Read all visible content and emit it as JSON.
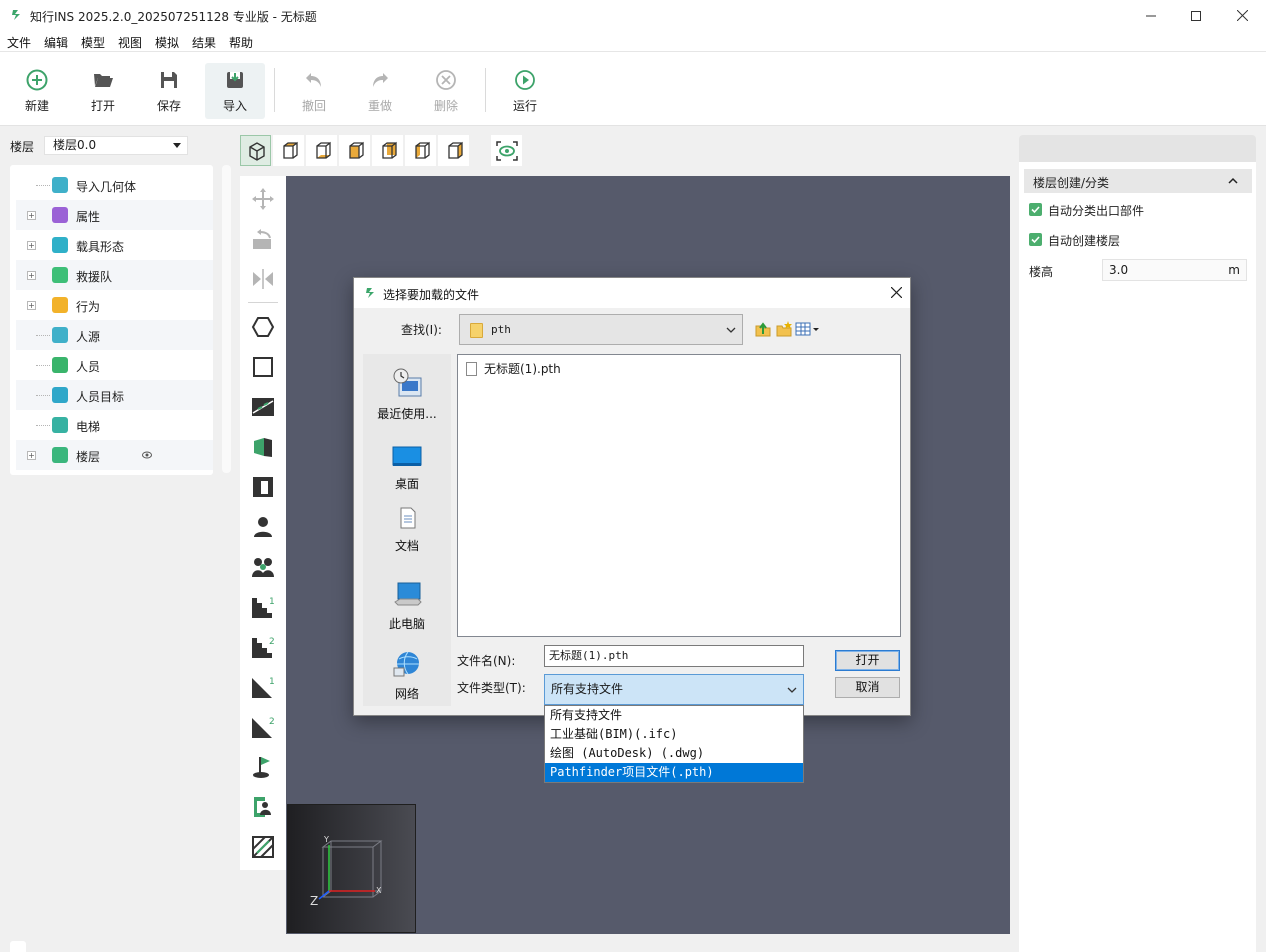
{
  "app": {
    "title": "知行INS 2025.2.0_202507251128 专业版 - 无标题"
  },
  "menu": [
    "文件",
    "编辑",
    "模型",
    "视图",
    "模拟",
    "结果",
    "帮助"
  ],
  "toolbar": {
    "new": "新建",
    "open": "打开",
    "save": "保存",
    "import": "导入",
    "undo": "撤回",
    "redo": "重做",
    "delete": "删除",
    "run": "运行"
  },
  "floor": {
    "label": "楼层",
    "selected": "楼层0.0"
  },
  "tree": [
    {
      "label": "导入几何体",
      "expandable": false,
      "color": "#3fb0c9"
    },
    {
      "label": "属性",
      "expandable": true,
      "color": "#9b62d6"
    },
    {
      "label": "载具形态",
      "expandable": true,
      "color": "#2fb0c8"
    },
    {
      "label": "救援队",
      "expandable": true,
      "color": "#3ebf78"
    },
    {
      "label": "行为",
      "expandable": true,
      "color": "#f2b22a"
    },
    {
      "label": "人源",
      "expandable": false,
      "color": "#3fb0c9"
    },
    {
      "label": "人员",
      "expandable": false,
      "color": "#39b46b"
    },
    {
      "label": "人员目标",
      "expandable": false,
      "color": "#2fa7c9"
    },
    {
      "label": "电梯",
      "expandable": false,
      "color": "#37b2a2"
    },
    {
      "label": "楼层",
      "expandable": true,
      "color": "#3ab67d"
    }
  ],
  "right_panel": {
    "section": "楼层创建/分类",
    "auto_classify": "自动分类出口部件",
    "auto_create": "自动创建楼层",
    "height_label": "楼高",
    "height_value": "3.0",
    "height_unit": "m"
  },
  "dialog": {
    "title": "选择要加载的文件",
    "look_in_label": "查找(I):",
    "look_in_value": "pth",
    "places": [
      "最近使用...",
      "桌面",
      "文档",
      "此电脑",
      "网络"
    ],
    "files": [
      "无标题(1).pth"
    ],
    "filename_label": "文件名(N):",
    "filename_value": "无标题(1).pth",
    "filetype_label": "文件类型(T):",
    "filetype_value": "所有支持文件",
    "open_button": "打开",
    "cancel_button": "取消",
    "filetype_options": [
      "所有支持文件",
      "工业基础(BIM)(.ifc)",
      "绘图 (AutoDesk) (.dwg)",
      "Pathfinder项目文件(.pth)"
    ],
    "filetype_highlighted": "Pathfinder项目文件(.pth)"
  },
  "navcube": {
    "x": "X",
    "y": "Y",
    "z": "Z"
  },
  "colors": {
    "accent_green": "#3da36a",
    "viewport": "#565a6b",
    "selection_blue": "#0078d7"
  }
}
